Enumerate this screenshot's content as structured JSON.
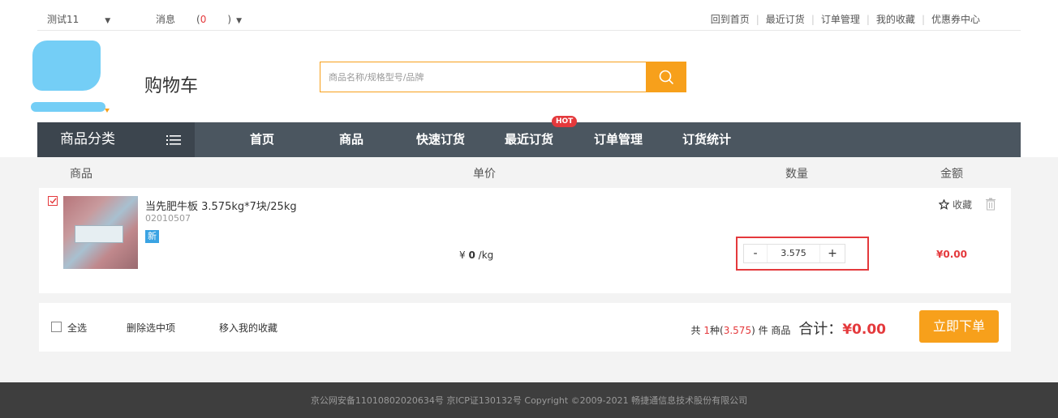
{
  "topbar": {
    "user": "测试11",
    "messages_label": "消息",
    "messages_count": "0",
    "links": [
      "回到首页",
      "最近订货",
      "订单管理",
      "我的收藏",
      "优惠券中心"
    ]
  },
  "header": {
    "title": "购物车",
    "search_placeholder": "商品名称/规格型号/品牌"
  },
  "nav": {
    "category": "商品分类",
    "items": [
      "首页",
      "商品",
      "快速订货",
      "最近订货",
      "订单管理",
      "订货统计"
    ],
    "hot_badge": "HOT"
  },
  "columns": {
    "product": "商品",
    "unit_price": "单价",
    "quantity": "数量",
    "amount": "金额"
  },
  "cart_item": {
    "name": "当先肥牛板 3.575kg*7块/25kg",
    "code": "02010507",
    "new_badge": "新",
    "price_symbol": "¥",
    "price": "0",
    "price_unit": "/kg",
    "quantity": "3.575",
    "minus": "-",
    "plus": "+",
    "amount": "¥0.00",
    "fav_label": "收藏",
    "checked": true
  },
  "footer_bar": {
    "select_all": "全选",
    "delete_selected": "删除选中项",
    "move_to_fav": "移入我的收藏",
    "sum_prefix": "共",
    "kinds": "1",
    "kinds_unit": "种(",
    "qty_total": "3.575",
    "qty_suffix": ") 件 商品",
    "total_label": "合计：",
    "total": "¥0.00",
    "order_button": "立即下单"
  },
  "page_footer": {
    "text": "京公网安备11010802020634号 京ICP证130132号 Copyright ©2009-2021 畅捷通信息技术股份有限公司"
  },
  "colors": {
    "accent": "#f7a01b",
    "nav_bg": "#4b5660",
    "price_red": "#e4393c"
  }
}
